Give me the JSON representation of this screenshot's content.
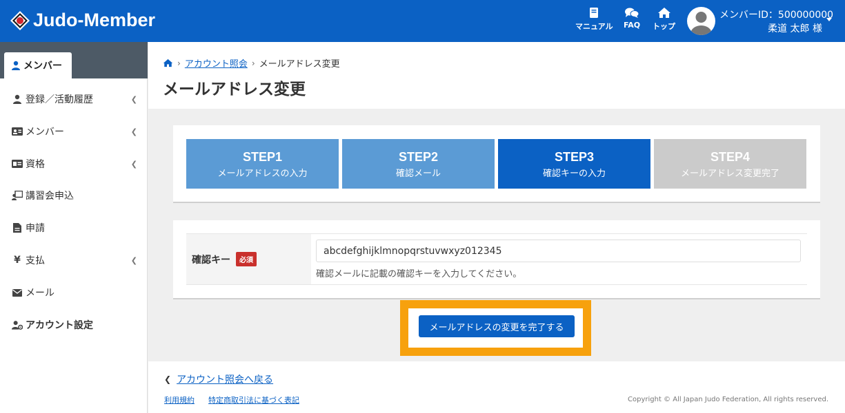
{
  "header": {
    "logo_text": "Judo-Member",
    "nav": [
      {
        "label": "マニュアル",
        "icon": "book-icon"
      },
      {
        "label": "FAQ",
        "icon": "chat-icon"
      },
      {
        "label": "トップ",
        "icon": "home-icon"
      }
    ],
    "member_id": "メンバーID：500000000",
    "member_name": "柔道 太郎 様"
  },
  "sidebar": {
    "active_tab": "メンバー",
    "items": [
      {
        "label": "登録／活動履歴",
        "icon": "user-icon",
        "has_chevron": true
      },
      {
        "label": "メンバー",
        "icon": "id-card-icon",
        "has_chevron": true
      },
      {
        "label": "資格",
        "icon": "license-icon",
        "has_chevron": true
      },
      {
        "label": "講習会申込",
        "icon": "lecture-icon",
        "has_chevron": false
      },
      {
        "label": "申請",
        "icon": "document-icon",
        "has_chevron": false
      },
      {
        "label": "支払",
        "icon": "yen-icon",
        "has_chevron": true
      },
      {
        "label": "メール",
        "icon": "envelope-icon",
        "has_chevron": false
      },
      {
        "label": "アカウント設定",
        "icon": "user-gear-icon",
        "has_chevron": false
      }
    ]
  },
  "breadcrumb": {
    "link": "アカウント照会",
    "current": "メールアドレス変更"
  },
  "page_title": "メールアドレス変更",
  "steps": [
    {
      "title": "STEP1",
      "sub": "メールアドレスの入力",
      "color": "#5b9bd5"
    },
    {
      "title": "STEP2",
      "sub": "確認メール",
      "color": "#5b9bd5"
    },
    {
      "title": "STEP3",
      "sub": "確認キーの入力",
      "color": "#0b61c4"
    },
    {
      "title": "STEP4",
      "sub": "メールアドレス変更完了",
      "color": "#cbcbcb"
    }
  ],
  "form": {
    "label": "確認キー",
    "required": "必須",
    "value": "abcdefghijklmnopqrstuvwxyz012345",
    "hint": "確認メールに記載の確認キーを入力してください。"
  },
  "complete_button": "メールアドレスの変更を完了する",
  "footer": {
    "back": "アカウント照会へ戻る",
    "terms": "利用規約",
    "commerce": "特定商取引法に基づく表記",
    "copyright": "Copyright © All Japan Judo Federation, All rights reserved."
  },
  "colors": {
    "brand": "#0b61c4",
    "step_done": "#5b9bd5",
    "step_pending": "#cbcbcb",
    "highlight": "#f7a10d",
    "required": "#c9302c"
  }
}
